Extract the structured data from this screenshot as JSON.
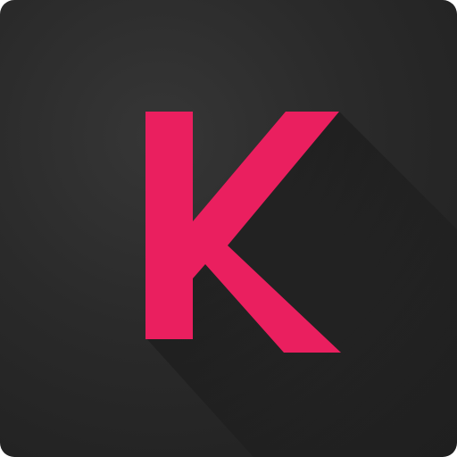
{
  "app_icon": {
    "letter": "K",
    "colors": {
      "background": "#2a2a2a",
      "letter": "#ea1f5f",
      "shadow": "#1a1a1a"
    }
  }
}
